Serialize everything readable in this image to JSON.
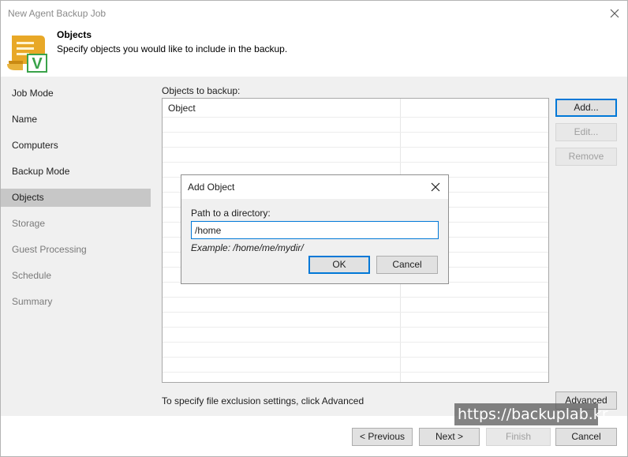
{
  "window": {
    "title": "New Agent Backup Job"
  },
  "header": {
    "title": "Objects",
    "subtitle": "Specify objects you would like to include in the backup.",
    "icon": "scroll-checkmark-icon",
    "icon_letter": "V"
  },
  "sidebar": {
    "items": [
      {
        "label": "Job Mode",
        "state": "normal"
      },
      {
        "label": "Name",
        "state": "normal"
      },
      {
        "label": "Computers",
        "state": "normal"
      },
      {
        "label": "Backup Mode",
        "state": "normal"
      },
      {
        "label": "Objects",
        "state": "selected"
      },
      {
        "label": "Storage",
        "state": "disabled"
      },
      {
        "label": "Guest Processing",
        "state": "disabled"
      },
      {
        "label": "Schedule",
        "state": "disabled"
      },
      {
        "label": "Summary",
        "state": "disabled"
      }
    ]
  },
  "main": {
    "objects_label": "Objects to backup:",
    "table": {
      "columns": [
        "Object"
      ],
      "rows": []
    },
    "buttons": {
      "add": "Add...",
      "edit": "Edit...",
      "remove": "Remove"
    },
    "exclusion_text": "To specify file exclusion settings, click Advanced",
    "advanced_button": "Advanced"
  },
  "footer": {
    "previous": "< Previous",
    "next": "Next >",
    "finish": "Finish",
    "cancel": "Cancel"
  },
  "dialog": {
    "title": "Add Object",
    "path_label": "Path to a directory:",
    "path_value": "/home",
    "example": "Example: /home/me/mydir/",
    "ok": "OK",
    "cancel": "Cancel"
  },
  "watermark": "https://backuplab.kr",
  "colors": {
    "accent": "#0078d7",
    "selected_nav": "#c7c7c7",
    "panel_bg": "#f0f0f0",
    "icon_gold": "#e8a827",
    "icon_green": "#3aa34a"
  }
}
